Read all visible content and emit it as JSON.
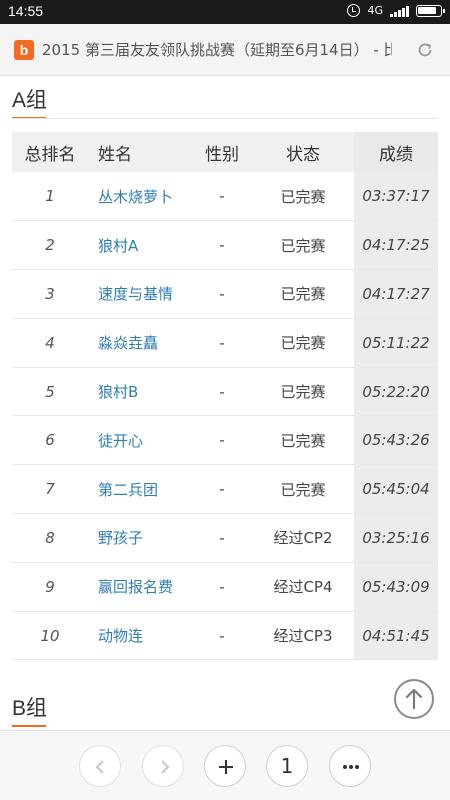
{
  "status_bar": {
    "time": "14:55",
    "signal_text": "4G"
  },
  "browser": {
    "site_icon_glyph": "b",
    "page_title": "2015 第三届友友领队挑战赛（延期至6月14日） - 比",
    "tab_count": "1"
  },
  "groups": {
    "a": {
      "heading": "A组"
    },
    "b": {
      "heading": "B组"
    }
  },
  "table": {
    "headers": {
      "rank": "总排名",
      "name": "姓名",
      "gender": "性别",
      "status": "状态",
      "score": "成绩"
    },
    "rows": [
      {
        "rank": "1",
        "name": "丛木烧萝卜",
        "gender": "-",
        "status": "已完赛",
        "score": "03:37:17"
      },
      {
        "rank": "2",
        "name": "狼村A",
        "gender": "-",
        "status": "已完赛",
        "score": "04:17:25"
      },
      {
        "rank": "3",
        "name": "速度与基情",
        "gender": "-",
        "status": "已完赛",
        "score": "04:17:27"
      },
      {
        "rank": "4",
        "name": "淼焱垚矗",
        "gender": "-",
        "status": "已完赛",
        "score": "05:11:22"
      },
      {
        "rank": "5",
        "name": "狼村B",
        "gender": "-",
        "status": "已完赛",
        "score": "05:22:20"
      },
      {
        "rank": "6",
        "name": "徒开心",
        "gender": "-",
        "status": "已完赛",
        "score": "05:43:26"
      },
      {
        "rank": "7",
        "name": "第二兵团",
        "gender": "-",
        "status": "已完赛",
        "score": "05:45:04"
      },
      {
        "rank": "8",
        "name": "野孩子",
        "gender": "-",
        "status": "经过CP2",
        "score": "03:25:16"
      },
      {
        "rank": "9",
        "name": "赢回报名费",
        "gender": "-",
        "status": "经过CP4",
        "score": "05:43:09"
      },
      {
        "rank": "10",
        "name": "动物连",
        "gender": "-",
        "status": "经过CP3",
        "score": "04:51:45"
      }
    ]
  },
  "colors": {
    "accent": "#f36b21",
    "link": "#2f7fb6"
  },
  "icons": {
    "refresh": "refresh-icon",
    "back_to_top": "arrow-up-icon",
    "back": "chevron-left-icon",
    "forward": "chevron-right-icon",
    "new_tab": "plus-icon",
    "menu": "more-dots-icon"
  }
}
